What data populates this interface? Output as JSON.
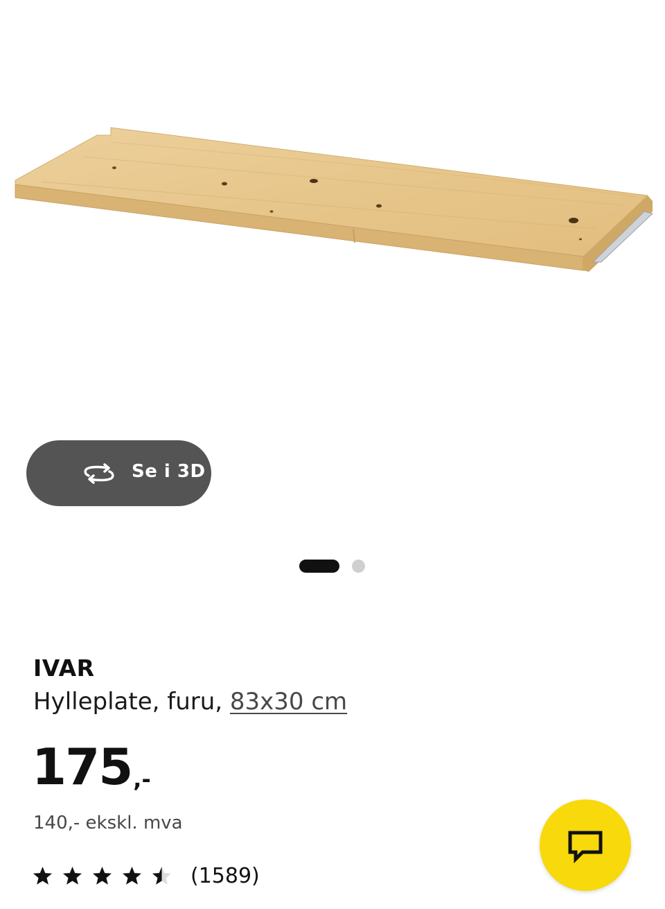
{
  "product_image": {
    "alt": "IVAR shelf, pine"
  },
  "view_3d": {
    "label": "Se i 3D",
    "icon": "rotate-3d-icon"
  },
  "carousel": {
    "total": 2,
    "active_index": 0
  },
  "product": {
    "brand": "IVAR",
    "description": "Hylleplate, furu,",
    "size": "83x30 cm",
    "price": "175",
    "price_suffix": ",-",
    "price_ex_vat": "140,- ekskl. mva"
  },
  "rating": {
    "value": 4.5,
    "max": 5,
    "review_count": "(1589)"
  },
  "chat": {
    "icon": "chat-icon",
    "color": "#f7d90c"
  },
  "colors": {
    "wood": "#e9c98f",
    "button_dark": "#545454"
  }
}
